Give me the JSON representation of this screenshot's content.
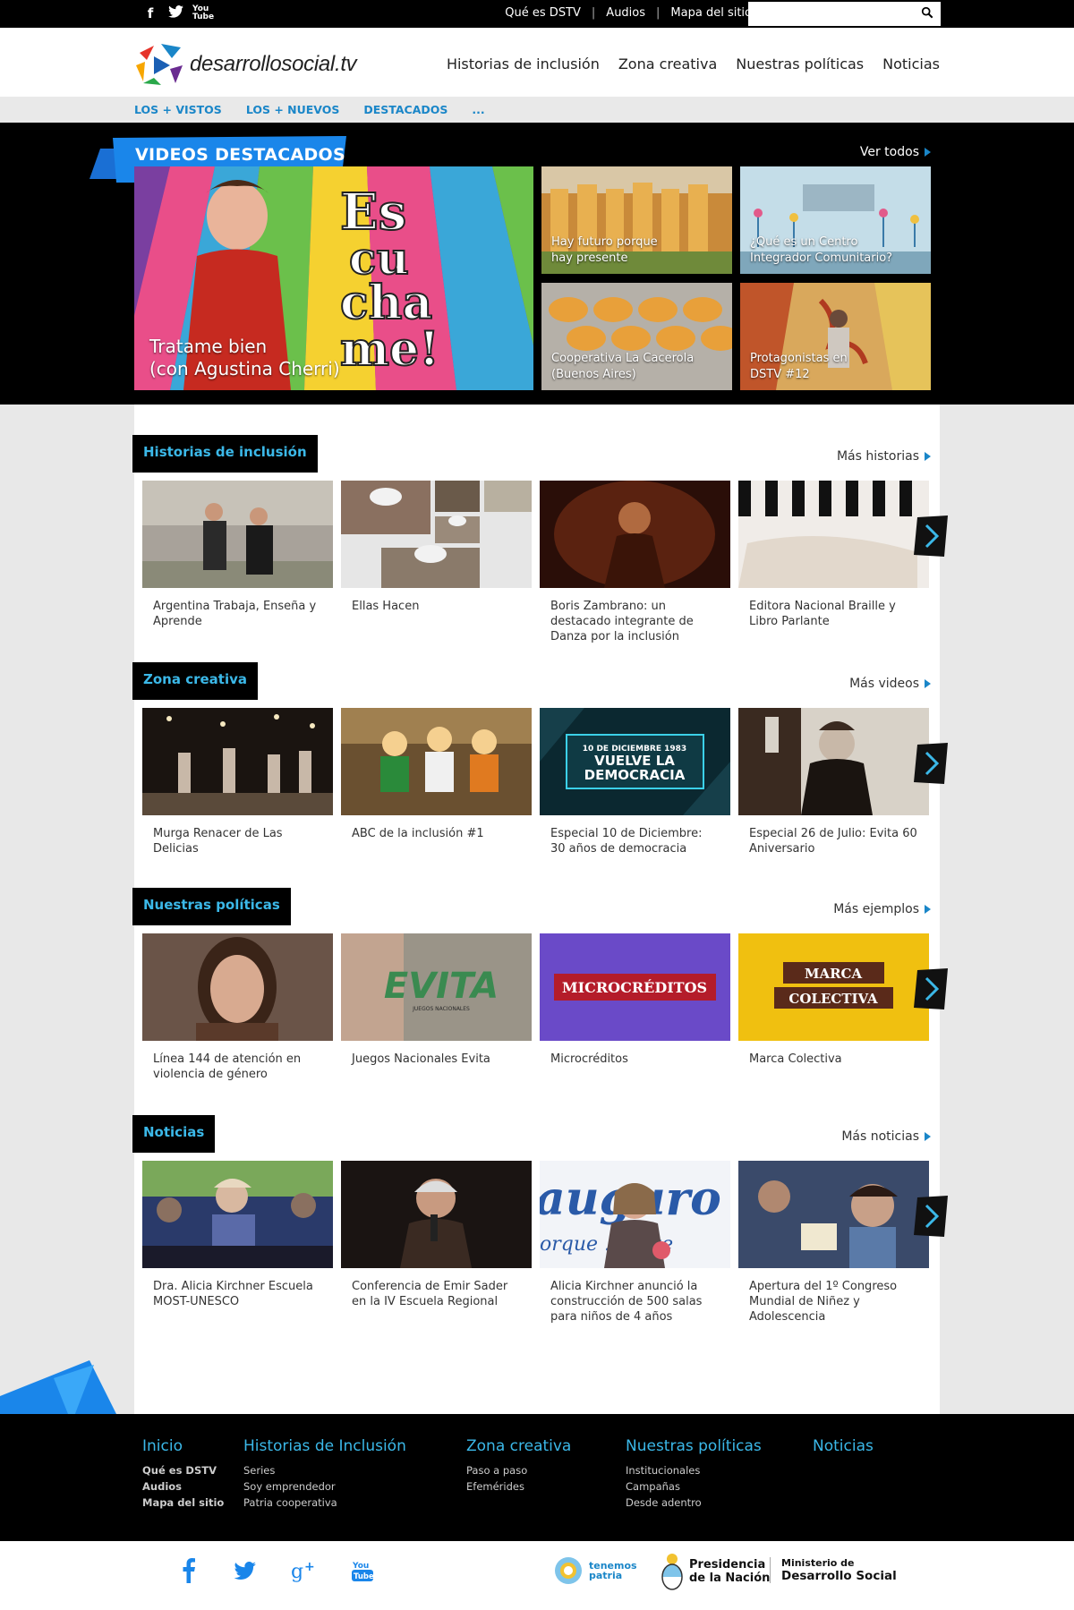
{
  "topbar": {
    "social": [
      "facebook-icon",
      "twitter-icon",
      "youtube-icon"
    ],
    "links": [
      "Qué es DSTV",
      "Audios",
      "Mapa del sitio"
    ],
    "search_placeholder": ""
  },
  "header": {
    "logo_text": "desarrollosocial.tv",
    "nav": [
      "Historias de inclusión",
      "Zona creativa",
      "Nuestras políticas",
      "Noticias"
    ]
  },
  "subnav": [
    "LOS + VISTOS",
    "LOS + NUEVOS",
    "DESTACADOS",
    "..."
  ],
  "hero": {
    "title": "VIDEOS DESTACADOS",
    "more": "Ver todos",
    "main": {
      "line1": "Tratame bien",
      "line2": "(con Agustina Cherri)"
    },
    "small": [
      {
        "line1": "Hay futuro porque",
        "line2": "hay presente"
      },
      {
        "line1": "¿Qué es un Centro",
        "line2": "Integrador Comunitario?"
      },
      {
        "line1": "Cooperativa La Cacerola",
        "line2": "(Buenos Aires)"
      },
      {
        "line1": "Protagonistas en",
        "line2": "DSTV #12"
      }
    ]
  },
  "sections": [
    {
      "title": "Historias de inclusión",
      "more": "Más historias",
      "cards": [
        "Argentina Trabaja, Enseña y Aprende",
        "Ellas Hacen",
        "Boris Zambrano: un destacado integrante de Danza por la inclusión",
        "Editora Nacional Braille y Libro Parlante"
      ]
    },
    {
      "title": "Zona creativa",
      "more": "Más videos",
      "cards": [
        "Murga Renacer de Las Delicias",
        "ABC de la inclusión #1",
        "Especial 10 de Diciembre: 30 años de democracia",
        "Especial 26 de Julio: Evita 60 Aniversario"
      ]
    },
    {
      "title": "Nuestras políticas",
      "more": "Más ejemplos",
      "cards": [
        "Línea 144 de atención en violencia de género",
        "Juegos Nacionales Evita",
        "Microcréditos",
        "Marca Colectiva"
      ]
    },
    {
      "title": "Noticias",
      "more": "Más noticias",
      "cards": [
        "Dra. Alicia Kirchner Escuela MOST-UNESCO",
        "Conferencia de Emir Sader en la IV Escuela Regional",
        "Alicia Kirchner anunció la construcción de 500 salas para niños de 4 años",
        "Apertura del 1º Congreso Mundial de Niñez y Adolescencia"
      ]
    }
  ],
  "thumb_text": {
    "escuchame": [
      "Es",
      "cu",
      "cha",
      "me!"
    ],
    "democracia_date": "10 DE DICIEMBRE 1983",
    "democracia_1": "VUELVE LA",
    "democracia_2": "DEMOCRACIA",
    "evita_logo": "EVITA",
    "evita_sub": "JUEGOS NACIONALES",
    "microcreditos": "MICROCRÉDITOS",
    "marca1": "MARCA",
    "marca2": "COLECTIVA",
    "banner_text": "auguro",
    "banner_text2": "orque ... ante"
  },
  "footer": {
    "cols": [
      {
        "title": "Inicio",
        "links": [
          "Qué es DSTV",
          "Audios",
          "Mapa del sitio"
        ]
      },
      {
        "title": "Historias de Inclusión",
        "links": [
          "Series",
          "Soy emprendedor",
          "Patria cooperativa"
        ]
      },
      {
        "title": "Zona creativa",
        "links": [
          "Paso a paso",
          "Efemérides"
        ]
      },
      {
        "title": "Nuestras políticas",
        "links": [
          "Institucionales",
          "Campañas",
          "Desde adentro"
        ]
      },
      {
        "title": "Noticias",
        "links": []
      }
    ]
  },
  "bottom": {
    "social": [
      "facebook-icon",
      "twitter-icon",
      "google-plus-icon",
      "youtube-icon"
    ],
    "brand1": {
      "line1": "tenemos",
      "line2": "patria"
    },
    "brand2": {
      "line1": "Presidencia",
      "line2": "de la Nación"
    },
    "brand3": {
      "line1": "Ministerio de",
      "line2": "Desarrollo Social"
    }
  },
  "colors": {
    "accent": "#1a86c8",
    "section_title": "#3bb8e8",
    "black": "#000000"
  }
}
